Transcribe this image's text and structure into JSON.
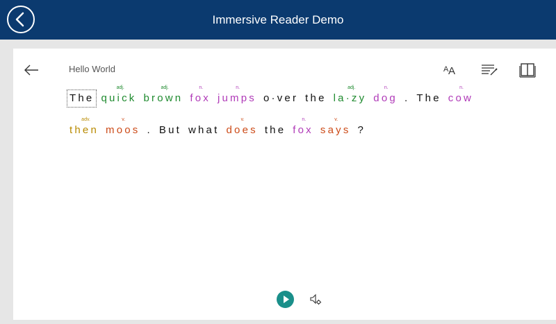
{
  "header": {
    "title": "Immersive Reader Demo",
    "back_icon": "back-arrow-circle-icon",
    "bg_color": "#0b3a6f"
  },
  "reader": {
    "doc_title": "Hello World",
    "toolbar": {
      "text_preferences_icon": "text-size-icon",
      "grammar_options_icon": "grammar-options-icon",
      "reading_preferences_icon": "book-icon"
    },
    "lines": [
      [
        {
          "text": "The",
          "pos": "",
          "class": "plain sel"
        },
        {
          "text": "quick",
          "pos": "adj.",
          "class": "adj"
        },
        {
          "text": "brown",
          "pos": "adj.",
          "class": "adj"
        },
        {
          "text": "fox",
          "pos": "n.",
          "class": "noun"
        },
        {
          "text": "jumps",
          "pos": "n.",
          "class": "noun"
        },
        {
          "text": "o·ver",
          "pos": "",
          "class": "plain"
        },
        {
          "text": "the",
          "pos": "",
          "class": "plain"
        },
        {
          "text": "la·zy",
          "pos": "adj.",
          "class": "adj"
        },
        {
          "text": "dog",
          "pos": "n.",
          "class": "noun"
        },
        {
          "text": ".",
          "pos": "",
          "class": "plain"
        },
        {
          "text": "The",
          "pos": "",
          "class": "plain"
        },
        {
          "text": "cow",
          "pos": "n.",
          "class": "noun"
        }
      ],
      [
        {
          "text": "then",
          "pos": "adv.",
          "class": "adv"
        },
        {
          "text": "moos",
          "pos": "v.",
          "class": "verb"
        },
        {
          "text": ".",
          "pos": "",
          "class": "plain"
        },
        {
          "text": "But",
          "pos": "",
          "class": "plain"
        },
        {
          "text": "what",
          "pos": "",
          "class": "plain"
        },
        {
          "text": "does",
          "pos": "v.",
          "class": "verb"
        },
        {
          "text": "the",
          "pos": "",
          "class": "plain"
        },
        {
          "text": "fox",
          "pos": "n.",
          "class": "noun"
        },
        {
          "text": "says",
          "pos": "v.",
          "class": "verb"
        },
        {
          "text": "?",
          "pos": "",
          "class": "plain"
        }
      ]
    ],
    "controls": {
      "play_icon": "play-icon",
      "voice_settings_icon": "voice-settings-icon",
      "play_color": "#1a8f8a"
    }
  }
}
